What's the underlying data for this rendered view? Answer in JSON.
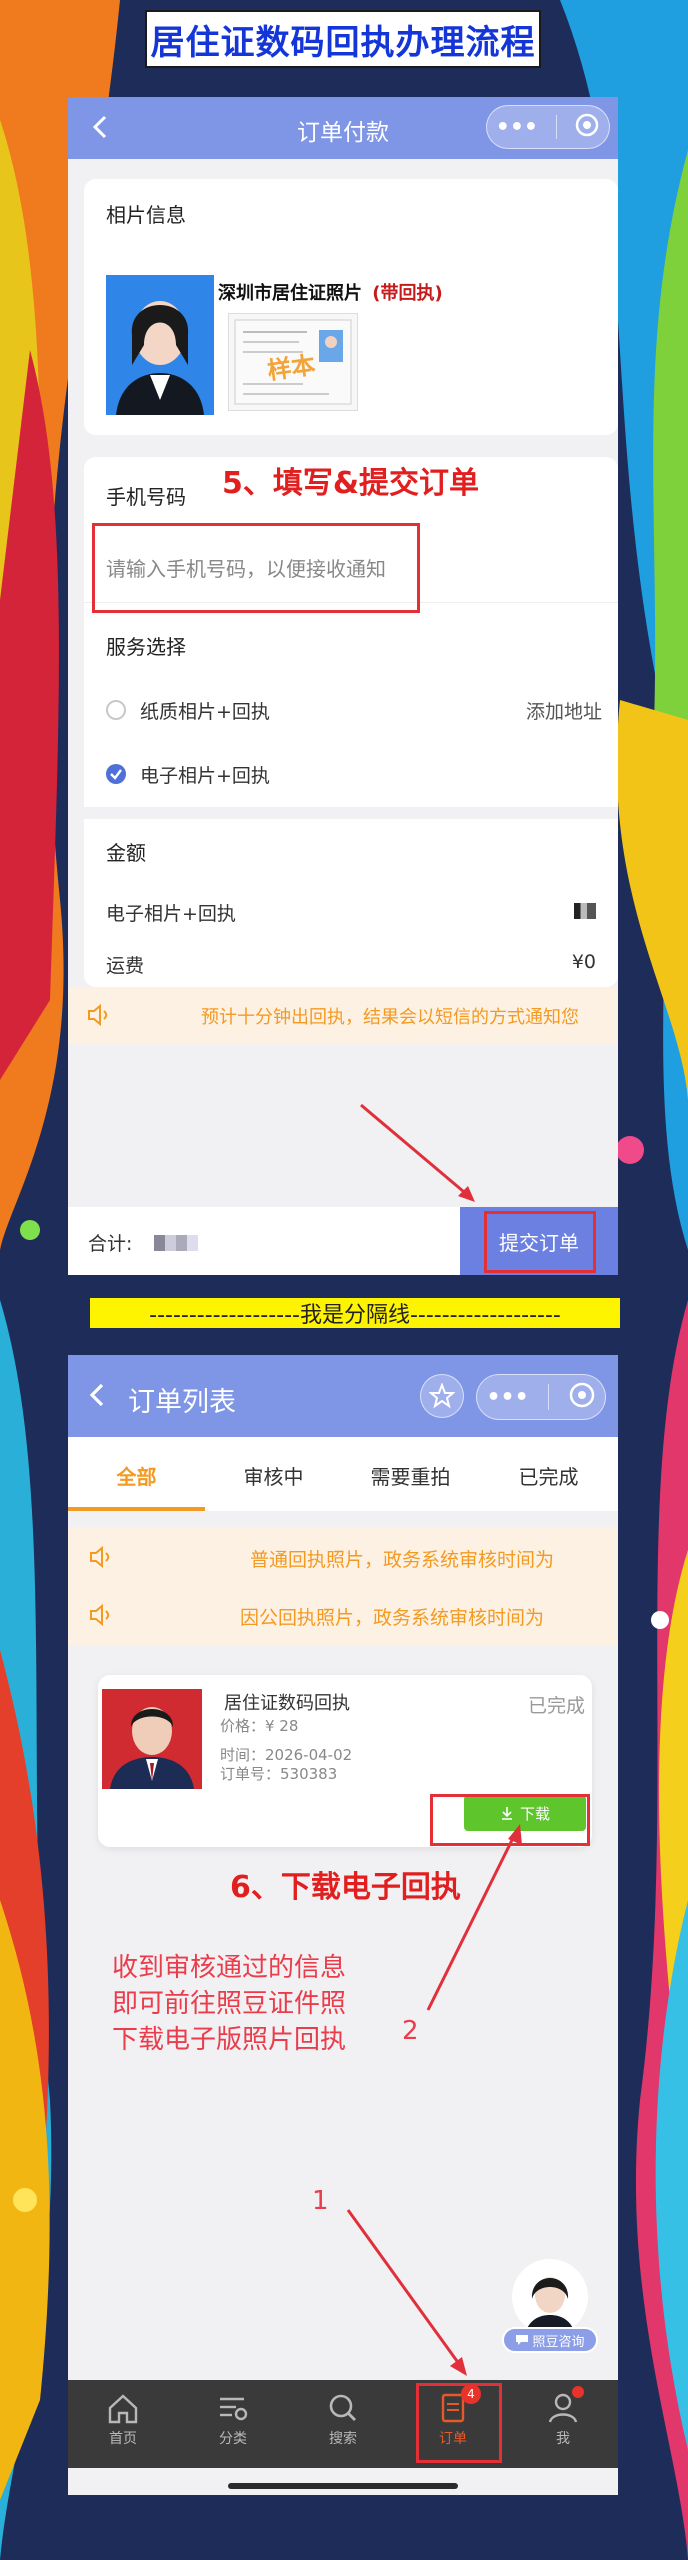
{
  "banner_title": "居住证数码回执办理流程",
  "top": {
    "nav_title": "订单付款",
    "photo_section_title": "相片信息",
    "product_name": "深圳市居住证照片",
    "product_tag": "(带回执)",
    "sample_watermark": "样本",
    "step_note": "5、填写&提交订单",
    "phone_label": "手机号码",
    "phone_placeholder": "请输入手机号码，以便接收通知",
    "service_title": "服务选择",
    "service_options": [
      {
        "label": "纸质相片+回执",
        "extra": "添加地址",
        "selected": false
      },
      {
        "label": "电子相片+回执",
        "extra": "",
        "selected": true
      }
    ],
    "amount_title": "金额",
    "amount_rows": [
      {
        "label": "电子相片+回执",
        "value": ""
      },
      {
        "label": "运费",
        "value": "¥0"
      }
    ],
    "notice": "预计十分钟出回执，结果会以短信的方式通知您",
    "total_label": "合计:",
    "submit_label": "提交订单"
  },
  "divider_text": "-------------------我是分隔线-------------------",
  "bottom": {
    "nav_title": "订单列表",
    "tabs": [
      {
        "label": "全部",
        "active": true
      },
      {
        "label": "审核中",
        "active": false
      },
      {
        "label": "需要重拍",
        "active": false
      },
      {
        "label": "已完成",
        "active": false
      }
    ],
    "notices": [
      "普通回执照片，政务系统审核时间为",
      "因公回执照片，政务系统审核时间为"
    ],
    "order": {
      "title": "居住证数码回执",
      "status": "已完成",
      "price": "价格：¥ 28",
      "time": "时间：2026-04-02",
      "order_no": "订单号：530383",
      "download_label": "下载"
    },
    "step_note": "6、下载电子回执",
    "instruction_lines": [
      "收到审核通过的信息",
      "即可前往照豆证件照",
      "下载电子版照片回执"
    ],
    "marker_1": "1",
    "marker_2": "2",
    "consult_label": "照豆咨询",
    "tabbar": [
      {
        "label": "首页",
        "icon": "home-icon"
      },
      {
        "label": "分类",
        "icon": "category-icon"
      },
      {
        "label": "搜索",
        "icon": "search-icon"
      },
      {
        "label": "订单",
        "icon": "order-icon",
        "badge": "4"
      },
      {
        "label": "我",
        "icon": "user-icon"
      }
    ]
  },
  "colors": {
    "nav": "#7f95e6",
    "accent_orange": "#f39a22",
    "red": "#e21f1f",
    "download_green": "#5fc52d",
    "banner_text": "#1435d8"
  }
}
